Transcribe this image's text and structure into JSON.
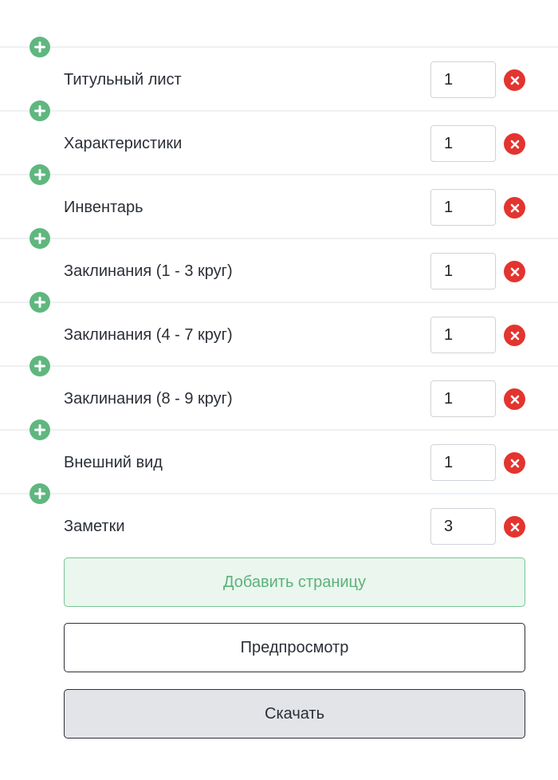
{
  "pages": [
    {
      "label": "Титульный лист",
      "count": "1"
    },
    {
      "label": "Характеристики",
      "count": "1"
    },
    {
      "label": "Инвентарь",
      "count": "1"
    },
    {
      "label": "Заклинания (1 - 3 круг)",
      "count": "1"
    },
    {
      "label": "Заклинания (4 - 7 круг)",
      "count": "1"
    },
    {
      "label": "Заклинания (8 - 9 круг)",
      "count": "1"
    },
    {
      "label": "Внешний вид",
      "count": "1"
    },
    {
      "label": "Заметки",
      "count": "3"
    }
  ],
  "icons": {
    "add": "plus-circle-icon",
    "remove": "x-circle-icon"
  },
  "colors": {
    "add_icon": "#5fb77f",
    "remove_icon": "#e3342f",
    "add_page_bg": "#eaf6ee",
    "add_page_text": "#5db17b",
    "download_bg": "#e2e4e8"
  },
  "actions": {
    "add_page_label": "Добавить страницу",
    "preview_label": "Предпросмотр",
    "download_label": "Скачать"
  }
}
